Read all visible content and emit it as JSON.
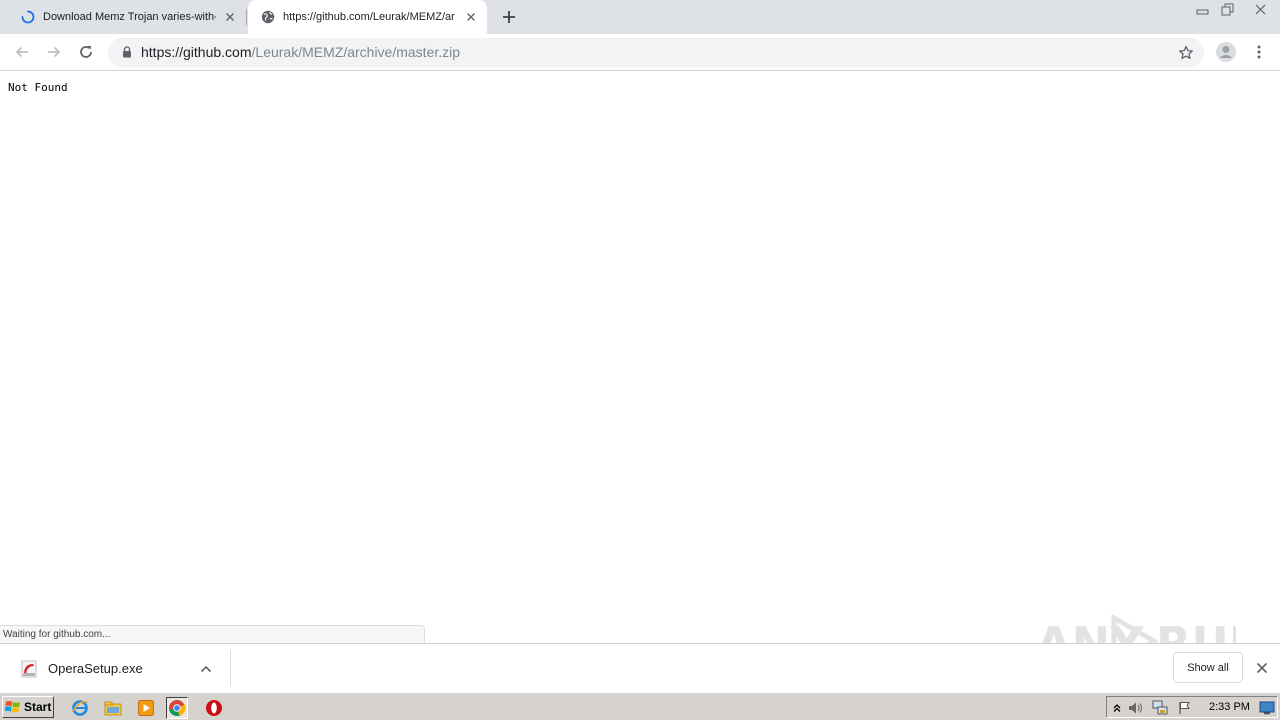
{
  "browser": {
    "tabs": [
      {
        "title": "Download Memz Trojan varies-with-d",
        "loading": true
      },
      {
        "title": "https://github.com/Leurak/MEMZ/ar",
        "active": true
      }
    ],
    "address_bar": {
      "host": "https://github.com",
      "path": "/Leurak/MEMZ/archive/master.zip"
    }
  },
  "page": {
    "body_text": "Not Found",
    "status_text": "Waiting for github.com..."
  },
  "downloads": {
    "items": [
      {
        "filename": "OperaSetup.exe"
      }
    ],
    "show_all_label": "Show all"
  },
  "watermark": {
    "text": "ANY RUN"
  },
  "taskbar": {
    "start_label": "Start",
    "clock": "2:33 PM"
  },
  "colors": {
    "tabstrip": "#dee1e6",
    "omnibox": "#f1f3f4",
    "loading_spinner": "#1a73e8",
    "taskbar": "#d6d3ce"
  }
}
